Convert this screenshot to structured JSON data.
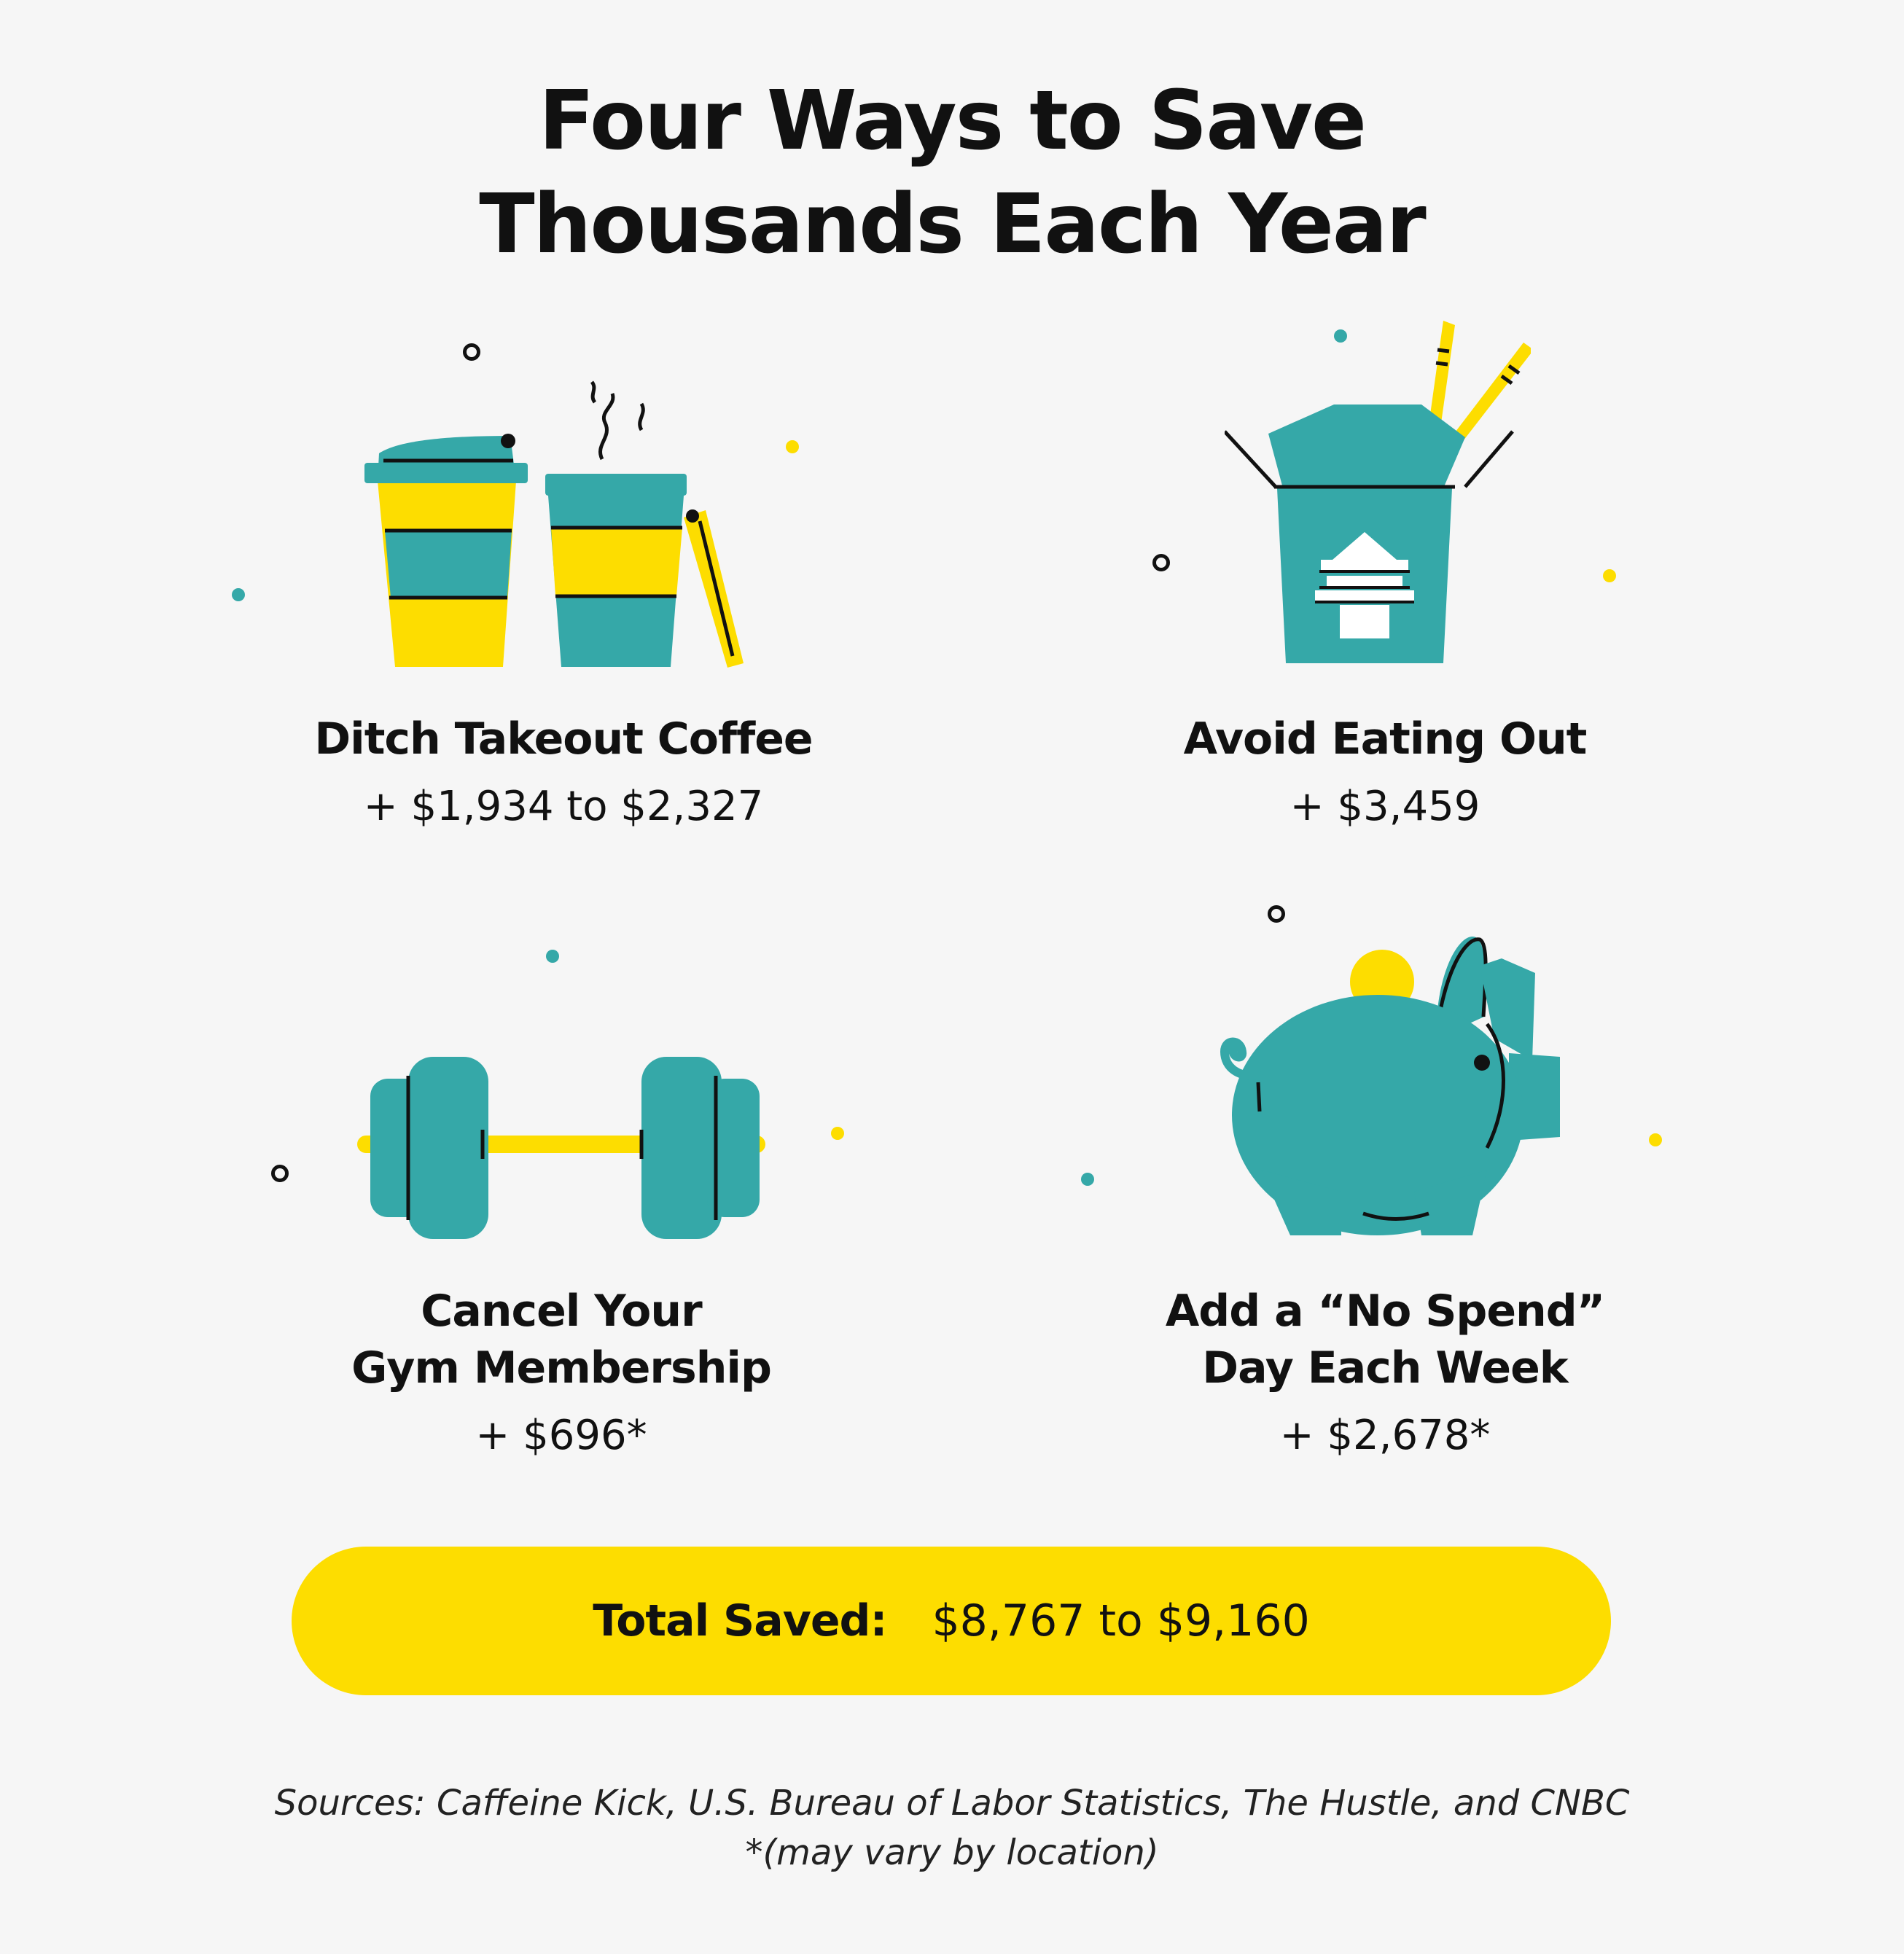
{
  "title": {
    "line1": "Four Ways to Save",
    "line2": "Thousands Each Year"
  },
  "cards": [
    {
      "title_line1": "Ditch Takeout Coffee",
      "title_line2": "",
      "amount": "+ $1,934 to $2,327",
      "icon": "coffee-cups-icon"
    },
    {
      "title_line1": "Avoid Eating Out",
      "title_line2": "",
      "amount": "+ $3,459",
      "icon": "takeout-box-icon"
    },
    {
      "title_line1": "Cancel Your",
      "title_line2": "Gym Membership",
      "amount": "+ $696*",
      "icon": "dumbbell-icon"
    },
    {
      "title_line1": "Add a “No Spend”",
      "title_line2": "Day Each Week",
      "amount": "+ $2,678*",
      "icon": "piggy-bank-icon"
    }
  ],
  "total": {
    "label": "Total Saved:",
    "value": "$8,767 to $9,160"
  },
  "footer": {
    "sources": "Sources: Caffeine Kick, U.S. Bureau of Labor Statistics, The Hustle, and CNBC",
    "note": "*(may vary by location)"
  },
  "colors": {
    "background": "#f6f6f6",
    "teal": "#35a8a8",
    "yellow": "#fddd00",
    "ink": "#111111"
  }
}
